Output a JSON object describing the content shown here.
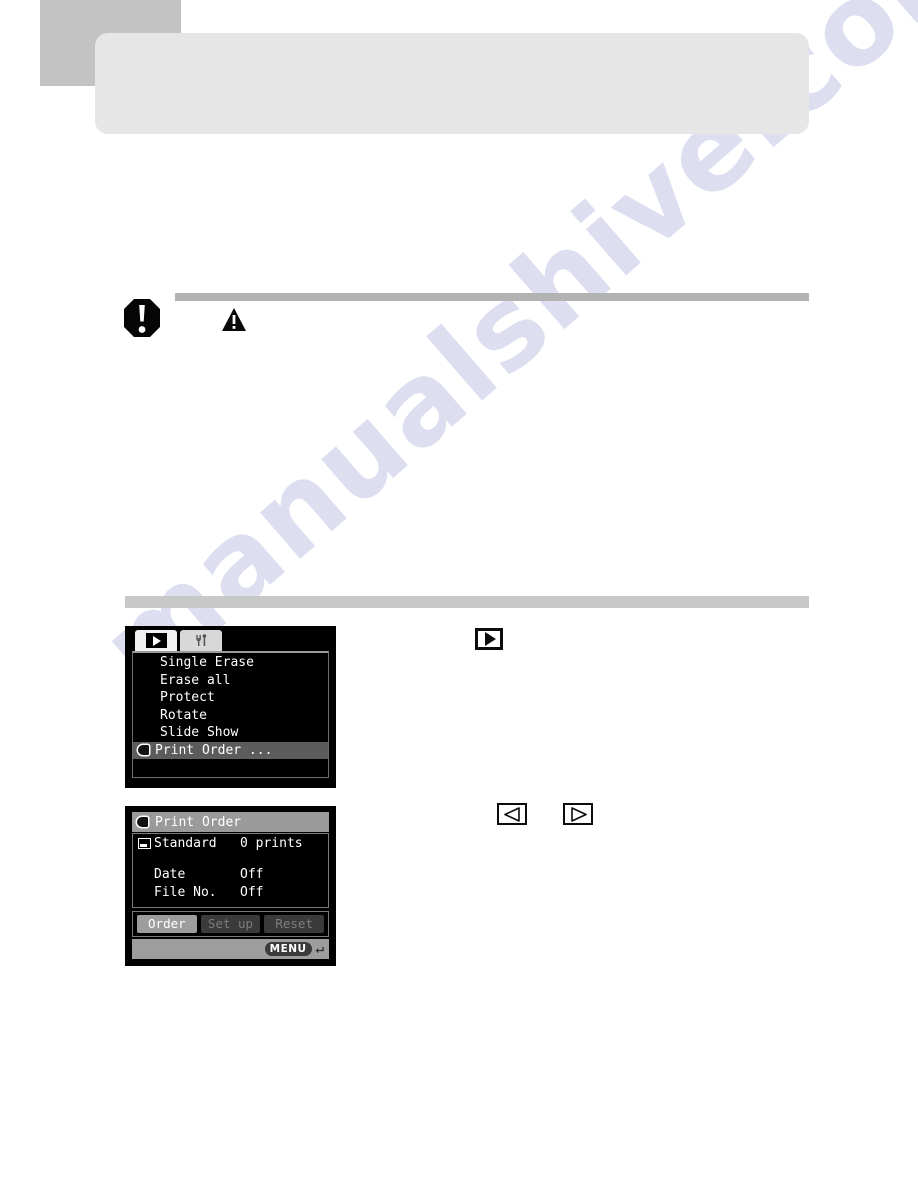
{
  "page": {
    "watermark_text": "manualshive.com",
    "background_color": "#ffffff"
  },
  "header": {
    "tab_marker": {
      "name": "chapter-tab-marker",
      "color": "#c3c3c3"
    },
    "banner": {
      "name": "section-title-banner",
      "color": "#e6e6e6"
    }
  },
  "caution": {
    "octagon_icon": "caution-octagon-icon",
    "triangle_icon": "warning-triangle-icon",
    "rule_color": "#b3b3b3"
  },
  "divider": {
    "color": "#c8c8c8"
  },
  "lcd_menu": {
    "tabs": [
      {
        "label": "",
        "icon": "playback-tab-icon",
        "active": true
      },
      {
        "label": "",
        "icon": "setup-tools-tab-icon",
        "active": false
      }
    ],
    "items": [
      {
        "label": "Single Erase",
        "selected": false
      },
      {
        "label": "Erase all",
        "selected": false
      },
      {
        "label": "Protect",
        "selected": false
      },
      {
        "label": "Rotate",
        "selected": false
      },
      {
        "label": "Slide Show",
        "selected": false
      },
      {
        "label": "Print Order ...",
        "selected": true,
        "icon": "print-order-icon"
      }
    ]
  },
  "lcd_print_order": {
    "title": "Print Order",
    "title_icon": "print-order-icon",
    "rows": [
      {
        "key": "Standard",
        "value": "0 prints",
        "icon": "standard-print-icon"
      },
      {
        "key": "Date",
        "value": "Off",
        "icon": ""
      },
      {
        "key": "File No.",
        "value": "Off",
        "icon": ""
      }
    ],
    "buttons": [
      {
        "label": "Order",
        "enabled": true
      },
      {
        "label": "Set up",
        "enabled": false
      },
      {
        "label": "Reset",
        "enabled": false
      }
    ],
    "footer": {
      "menu_badge": "MENU",
      "back_icon": "return-arrow-icon"
    }
  },
  "callouts": {
    "playback_button": {
      "icon": "playback-button-icon"
    },
    "left_arrow": {
      "icon": "left-arrow-key-icon"
    },
    "right_arrow": {
      "icon": "right-arrow-key-icon"
    }
  }
}
